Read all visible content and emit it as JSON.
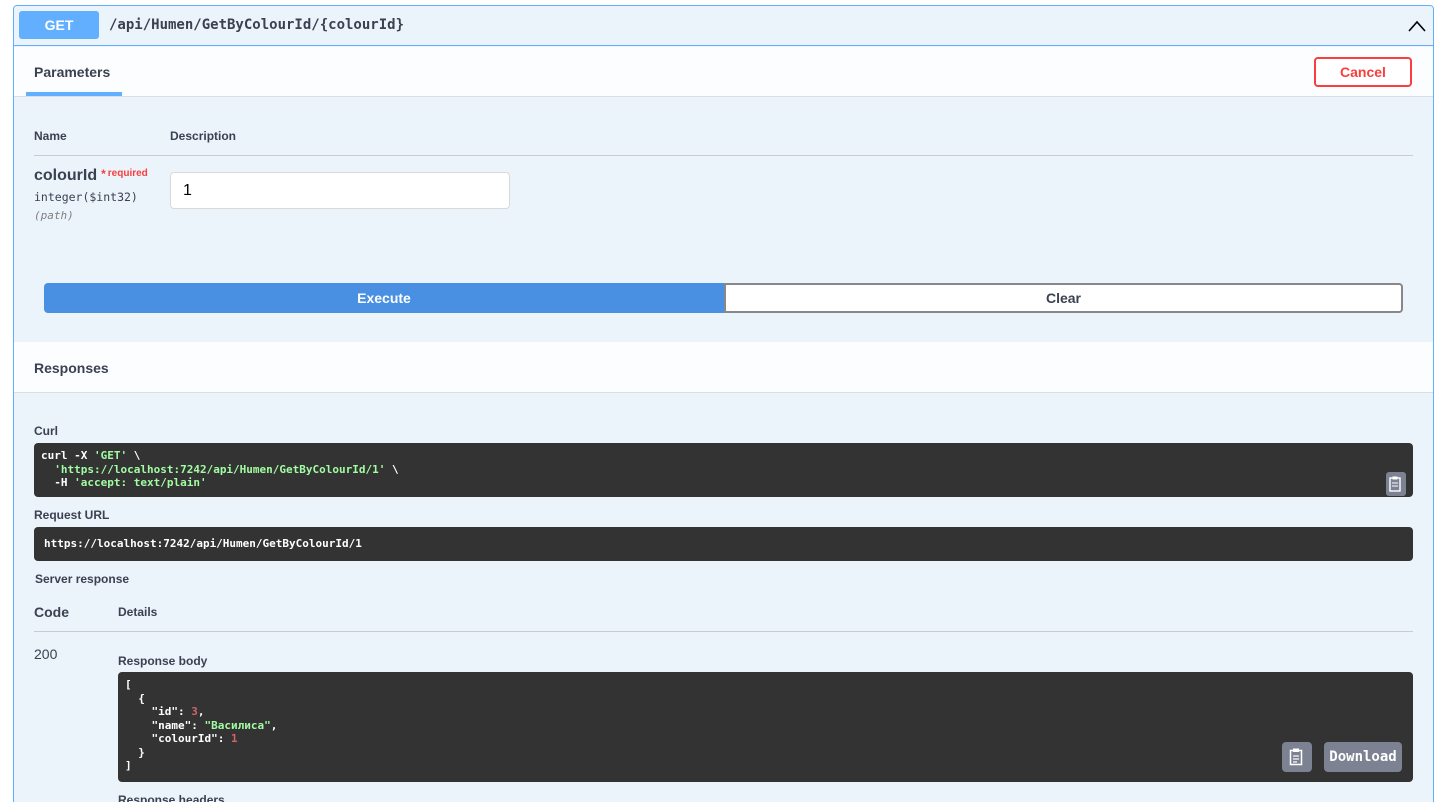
{
  "summary": {
    "method": "GET",
    "path": "/api/Humen/GetByColourId/{colourId}"
  },
  "parameters": {
    "tab_label": "Parameters",
    "cancel_label": "Cancel",
    "col_name": "Name",
    "col_description": "Description",
    "items": [
      {
        "name": "colourId",
        "required_star": "*",
        "required_label": "required",
        "type": "integer($int32)",
        "in": "(path)",
        "value": "1"
      }
    ]
  },
  "actions": {
    "execute_label": "Execute",
    "clear_label": "Clear"
  },
  "responses": {
    "title": "Responses",
    "curl_label": "Curl",
    "curl_line1_a": "curl -X ",
    "curl_line1_b": "'GET'",
    "curl_line1_c": " \\",
    "curl_line2_a": "  ",
    "curl_line2_b": "'https://localhost:7242/api/Humen/GetByColourId/1'",
    "curl_line2_c": " \\",
    "curl_line3_a": "  -H ",
    "curl_line3_b": "'accept: text/plain'",
    "request_url_label": "Request URL",
    "request_url": "https://localhost:7242/api/Humen/GetByColourId/1",
    "server_response_label": "Server response",
    "col_code": "Code",
    "col_details": "Details",
    "status_code": "200",
    "response_body_label": "Response body",
    "body": {
      "open_bracket": "[",
      "open_brace": "  {",
      "id_key": "    \"id\": ",
      "id_val": "3",
      "name_key": "    \"name\": ",
      "name_val": "\"Василиса\"",
      "colour_key": "    \"colourId\": ",
      "colour_val": "1",
      "close_brace": "  }",
      "close_bracket": "]"
    },
    "download_label": "Download",
    "response_headers_label": "Response headers"
  },
  "colors": {
    "get_blue": "#61affe",
    "execute_blue": "#4990e2",
    "cancel_red": "#f93e3e",
    "code_bg": "#333333"
  }
}
